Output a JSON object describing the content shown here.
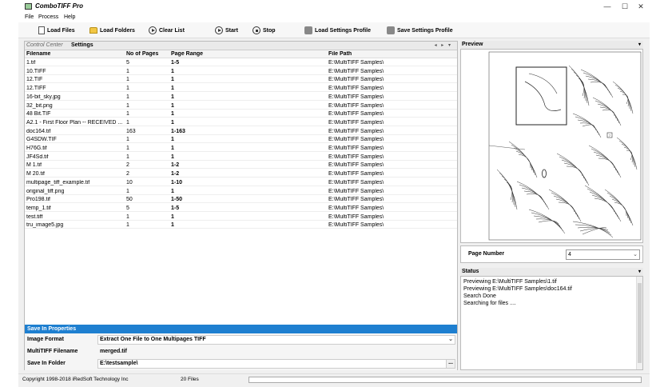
{
  "window": {
    "title": "ComboTIFF Pro",
    "controls": [
      "—",
      "☐",
      "✕"
    ]
  },
  "menu": [
    "File",
    "Process",
    "Help"
  ],
  "toolbar": {
    "load_files": "Load Files",
    "load_folders": "Load Folders",
    "clear_list": "Clear List",
    "start": "Start",
    "stop": "Stop",
    "load_profile": "Load Settings Profile",
    "save_profile": "Save Settings Profile"
  },
  "tabs": [
    "Control Center",
    "Settings"
  ],
  "grid": {
    "columns": [
      "Filename",
      "No of Pages",
      "Page Range",
      "File Path"
    ],
    "rows": [
      [
        "1.tif",
        "5",
        "1-5",
        "E:\\MultiTIFF Samples\\"
      ],
      [
        "10.TIFF",
        "1",
        "1",
        "E:\\MultiTIFF Samples\\"
      ],
      [
        "12.TIF",
        "1",
        "1",
        "E:\\MultiTIFF Samples\\"
      ],
      [
        "12.TIFF",
        "1",
        "1",
        "E:\\MultiTIFF Samples\\"
      ],
      [
        "16-bit_sky.jpg",
        "1",
        "1",
        "E:\\MultiTIFF Samples\\"
      ],
      [
        "32_bit.png",
        "1",
        "1",
        "E:\\MultiTIFF Samples\\"
      ],
      [
        "48 Bit.TIF",
        "1",
        "1",
        "E:\\MultiTIFF Samples\\"
      ],
      [
        "A2.1 - First Floor Plan -- RECEIVED ...",
        "1",
        "1",
        "E:\\MultiTIFF Samples\\"
      ],
      [
        "doc164.tif",
        "163",
        "1-163",
        "E:\\MultiTIFF Samples\\"
      ],
      [
        "G4SDW.TIF",
        "1",
        "1",
        "E:\\MultiTIFF Samples\\"
      ],
      [
        "H76G.tif",
        "1",
        "1",
        "E:\\MultiTIFF Samples\\"
      ],
      [
        "JF4Sd.tif",
        "1",
        "1",
        "E:\\MultiTIFF Samples\\"
      ],
      [
        "M 1.tif",
        "2",
        "1-2",
        "E:\\MultiTIFF Samples\\"
      ],
      [
        "M 20.tif",
        "2",
        "1-2",
        "E:\\MultiTIFF Samples\\"
      ],
      [
        "multipage_tiff_example.tif",
        "10",
        "1-10",
        "E:\\MultiTIFF Samples\\"
      ],
      [
        "original_tiff.png",
        "1",
        "1",
        "E:\\MultiTIFF Samples\\"
      ],
      [
        "Pro198.tif",
        "50",
        "1-50",
        "E:\\MultiTIFF Samples\\"
      ],
      [
        "temp_1.tif",
        "5",
        "1-5",
        "E:\\MultiTIFF Samples\\"
      ],
      [
        "test.tiff",
        "1",
        "1",
        "E:\\MultiTIFF Samples\\"
      ],
      [
        "tru_image5.jpg",
        "1",
        "1",
        "E:\\MultiTIFF Samples\\"
      ]
    ]
  },
  "save_props": {
    "title": "Save In Properties",
    "image_format_label": "Image Format",
    "image_format_value": "Extract One File to One Multipages TIFF",
    "filename_label": "MultiTIFF Filename",
    "filename_value": "merged.tif",
    "folder_label": "Save In Folder",
    "folder_value": "E:\\testsample\\",
    "browse": "..."
  },
  "statusbar": {
    "copyright": "Copyright 1998-2018 iRedSoft Technology Inc",
    "file_count": "20 Files"
  },
  "preview": {
    "title": "Preview",
    "page_number_label": "Page Number",
    "page_number_value": "4"
  },
  "status": {
    "title": "Status",
    "lines": [
      "Previewing E:\\MultiTIFF Samples\\1.tif",
      "Previewing E:\\MultiTIFF Samples\\doc164.tif",
      "Search Done",
      "Searching for files ...."
    ]
  }
}
